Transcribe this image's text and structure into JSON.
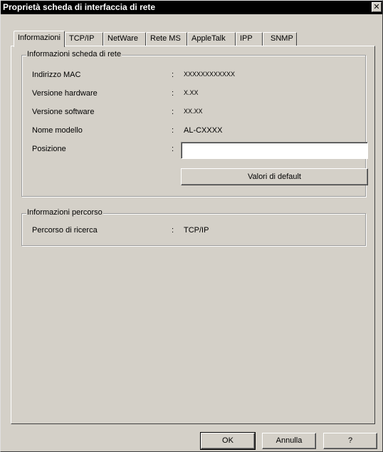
{
  "window": {
    "title": "Proprietà scheda di interfaccia di rete"
  },
  "tabs": [
    {
      "label": "Informazioni",
      "active": true
    },
    {
      "label": "TCP/IP",
      "active": false
    },
    {
      "label": "NetWare",
      "active": false
    },
    {
      "label": "Rete MS",
      "active": false
    },
    {
      "label": "AppleTalk",
      "active": false
    },
    {
      "label": "IPP",
      "active": false
    },
    {
      "label": "SNMP",
      "active": false
    }
  ],
  "network_info": {
    "legend": "Informazioni scheda di rete",
    "rows": [
      {
        "label": "Indirizzo MAC",
        "value": "XXXXXXXXXXXX"
      },
      {
        "label": "Versione hardware",
        "value": "X.XX"
      },
      {
        "label": "Versione software",
        "value": "XX.XX"
      },
      {
        "label": "Nome modello",
        "value": "AL-CXXXX"
      }
    ],
    "position_label": "Posizione",
    "position_value": "",
    "default_button": "Valori di default"
  },
  "path_info": {
    "legend": "Informazioni percorso",
    "label": "Percorso di ricerca",
    "value": "TCP/IP"
  },
  "colon": ":",
  "buttons": {
    "ok": "OK",
    "cancel": "Annulla",
    "help": "?"
  }
}
